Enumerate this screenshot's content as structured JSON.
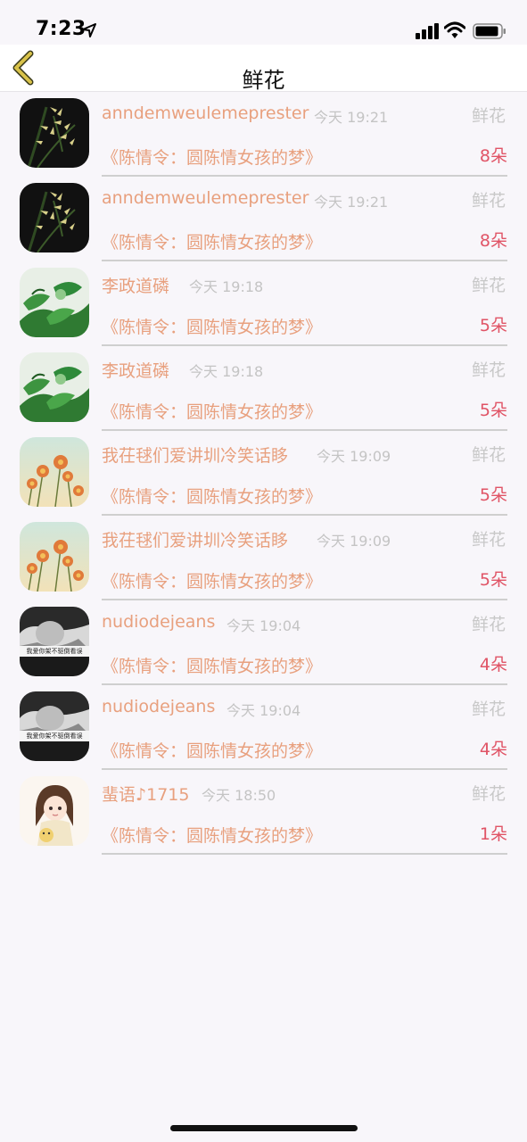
{
  "status_bar": {
    "time": "7:23"
  },
  "nav": {
    "title": "鲜花"
  },
  "records": [
    {
      "username": "anndemweulemeprester",
      "time": "今天 19:21",
      "gift_label": "鲜花",
      "drama": "《陈情令：圆陈情女孩的梦》",
      "count": "8朵",
      "avatar": "orchid-avatar"
    },
    {
      "username": "anndemweulemeprester",
      "time": "今天 19:21",
      "gift_label": "鲜花",
      "drama": "《陈情令：圆陈情女孩的梦》",
      "count": "8朵",
      "avatar": "orchid-avatar"
    },
    {
      "username": "李政道磷",
      "time": "今天 19:18",
      "gift_label": "鲜花",
      "drama": "《陈情令：圆陈情女孩的梦》",
      "count": "5朵",
      "avatar": "green-leaf-avatar"
    },
    {
      "username": "李政道磷",
      "time": "今天 19:18",
      "gift_label": "鲜花",
      "drama": "《陈情令：圆陈情女孩的梦》",
      "count": "5朵",
      "avatar": "green-leaf-avatar"
    },
    {
      "username": "我茌毬们爱讲圳冷笑话眵",
      "time": "今天 19:09",
      "gift_label": "鲜花",
      "drama": "《陈情令：圆陈情女孩的梦》",
      "count": "5朵",
      "avatar": "daisy-avatar"
    },
    {
      "username": "我茌毬们爱讲圳冷笑话眵",
      "time": "今天 19:09",
      "gift_label": "鲜花",
      "drama": "《陈情令：圆陈情女孩的梦》",
      "count": "5朵",
      "avatar": "daisy-avatar"
    },
    {
      "username": "nudiodejeans",
      "time": "今天 19:04",
      "gift_label": "鲜花",
      "drama": "《陈情令：圆陈情女孩的梦》",
      "count": "4朵",
      "avatar": "bw-portrait-avatar",
      "avatar_caption": "我爱你架不驱倒看误"
    },
    {
      "username": "nudiodejeans",
      "time": "今天 19:04",
      "gift_label": "鲜花",
      "drama": "《陈情令：圆陈情女孩的梦》",
      "count": "4朵",
      "avatar": "bw-portrait-avatar",
      "avatar_caption": "我爱你架不驱倒看误"
    },
    {
      "username": "蜚语♪1715",
      "time": "今天 18:50",
      "gift_label": "鲜花",
      "drama": "《陈情令：圆陈情女孩的梦》",
      "count": "1朵",
      "avatar": "anime-girl-avatar"
    }
  ],
  "colors": {
    "username": "#e8a07e",
    "count": "#e05466",
    "muted": "#c4c4c4",
    "back_arrow": "#c8b43a",
    "background": "#f8f6fa"
  }
}
